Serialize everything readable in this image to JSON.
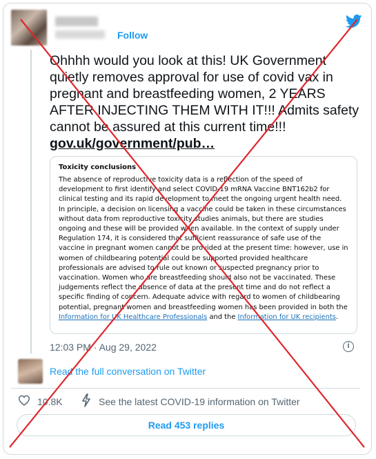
{
  "header": {
    "follow_label": "Follow",
    "platform_icon": "twitter-bird-icon"
  },
  "tweet": {
    "text": "Ohhhh would you look at this! UK Government quietly removes approval for use of covid vax in pregnant and breastfeeding women, 2 YEARS AFTER INJECTING THEM WITH IT!!! Admits safety cannot be assured at  this current time!!!",
    "link": "gov.uk/government/pub…"
  },
  "quote": {
    "title": "Toxicity conclusions",
    "body": "The absence of reproductive toxicity data is a reflection of the speed of development to first identify and select COVID-19 mRNA Vaccine BNT162b2 for clinical testing and its rapid development to meet the ongoing urgent health need. In principle, a decision on licensing a vaccine could be taken in these circumstances without data from reproductive toxicity studies animals, but there are studies ongoing and these will be provided when available. In the context of supply under Regulation 174, it is considered that sufficient reassurance of safe use of the vaccine in pregnant women cannot be provided at the present time: however, use in women of childbearing potential could be supported provided healthcare professionals are advised to rule out known or suspected pregnancy prior to vaccination. Women who are breastfeeding should also not be vaccinated. These judgements reflect the absence of data at the present time and do not reflect a specific finding of concern. Adequate advice with regard to women of childbearing potential, pregnant women and breastfeeding women has been provided in both the ",
    "link1": "Information for UK Healthcare Professionals",
    "and_text": " and the ",
    "link2": "Information for UK recipients",
    "end": "."
  },
  "timestamp": "12:03 PM · Aug 29, 2022",
  "read_conversation": "Read the full conversation on Twitter",
  "actions": {
    "likes": "10.8K",
    "see_latest": "See the latest COVID-19 information on Twitter",
    "read_replies": "Read 453 replies"
  },
  "colors": {
    "accent": "#1d9bf0",
    "cross": "#e0262b"
  }
}
